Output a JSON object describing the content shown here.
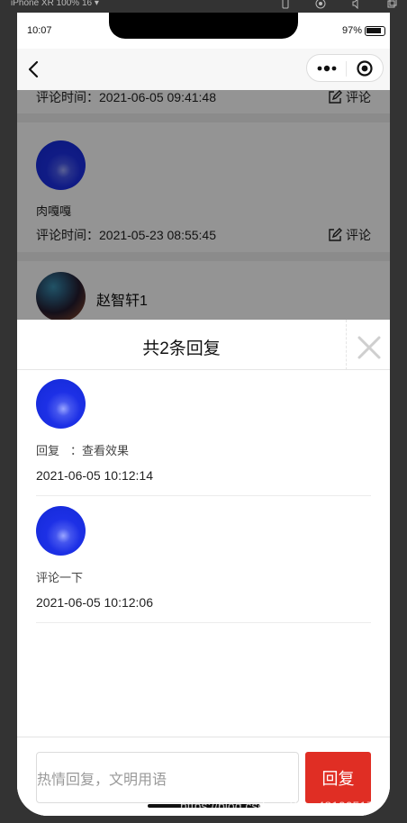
{
  "devtools": {
    "device_label": "iPhone XR 100% 16 ▾"
  },
  "status_bar": {
    "time": "10:07",
    "battery": "97%"
  },
  "navbar": {
    "back_icon": "chevron-left-icon",
    "menu_icon": "more-dots-icon",
    "target_icon": "target-icon"
  },
  "background_comments": {
    "items": [
      {
        "time_label": "评论时间：2021-06-05 09:41:48",
        "action_label": "评论"
      },
      {
        "user_name": "ㅤ",
        "content": "肉嘎嘎",
        "time_label": "评论时间：2021-05-23 08:55:45",
        "action_label": "评论"
      },
      {
        "user_name": "赵智轩1"
      }
    ]
  },
  "reply_sheet": {
    "title": "共2条回复",
    "close_icon": "close-icon",
    "replies": [
      {
        "user_name": "ㅤ",
        "content": "回复ㅤ：查看效果",
        "date": "2021-06-05 10:12:14"
      },
      {
        "user_name": "ㅤ",
        "content": "评论一下",
        "date": "2021-06-05 10:12:06"
      }
    ]
  },
  "composer": {
    "placeholder": "热情回复，文明用语",
    "send_label": "回复"
  },
  "watermark": "https://blog.csdn.net/qq_48100517",
  "colors": {
    "send_button": "#e02e24",
    "overlay": "rgba(0,0,0,0.42)",
    "avatar_blue": "#1d30e6"
  }
}
